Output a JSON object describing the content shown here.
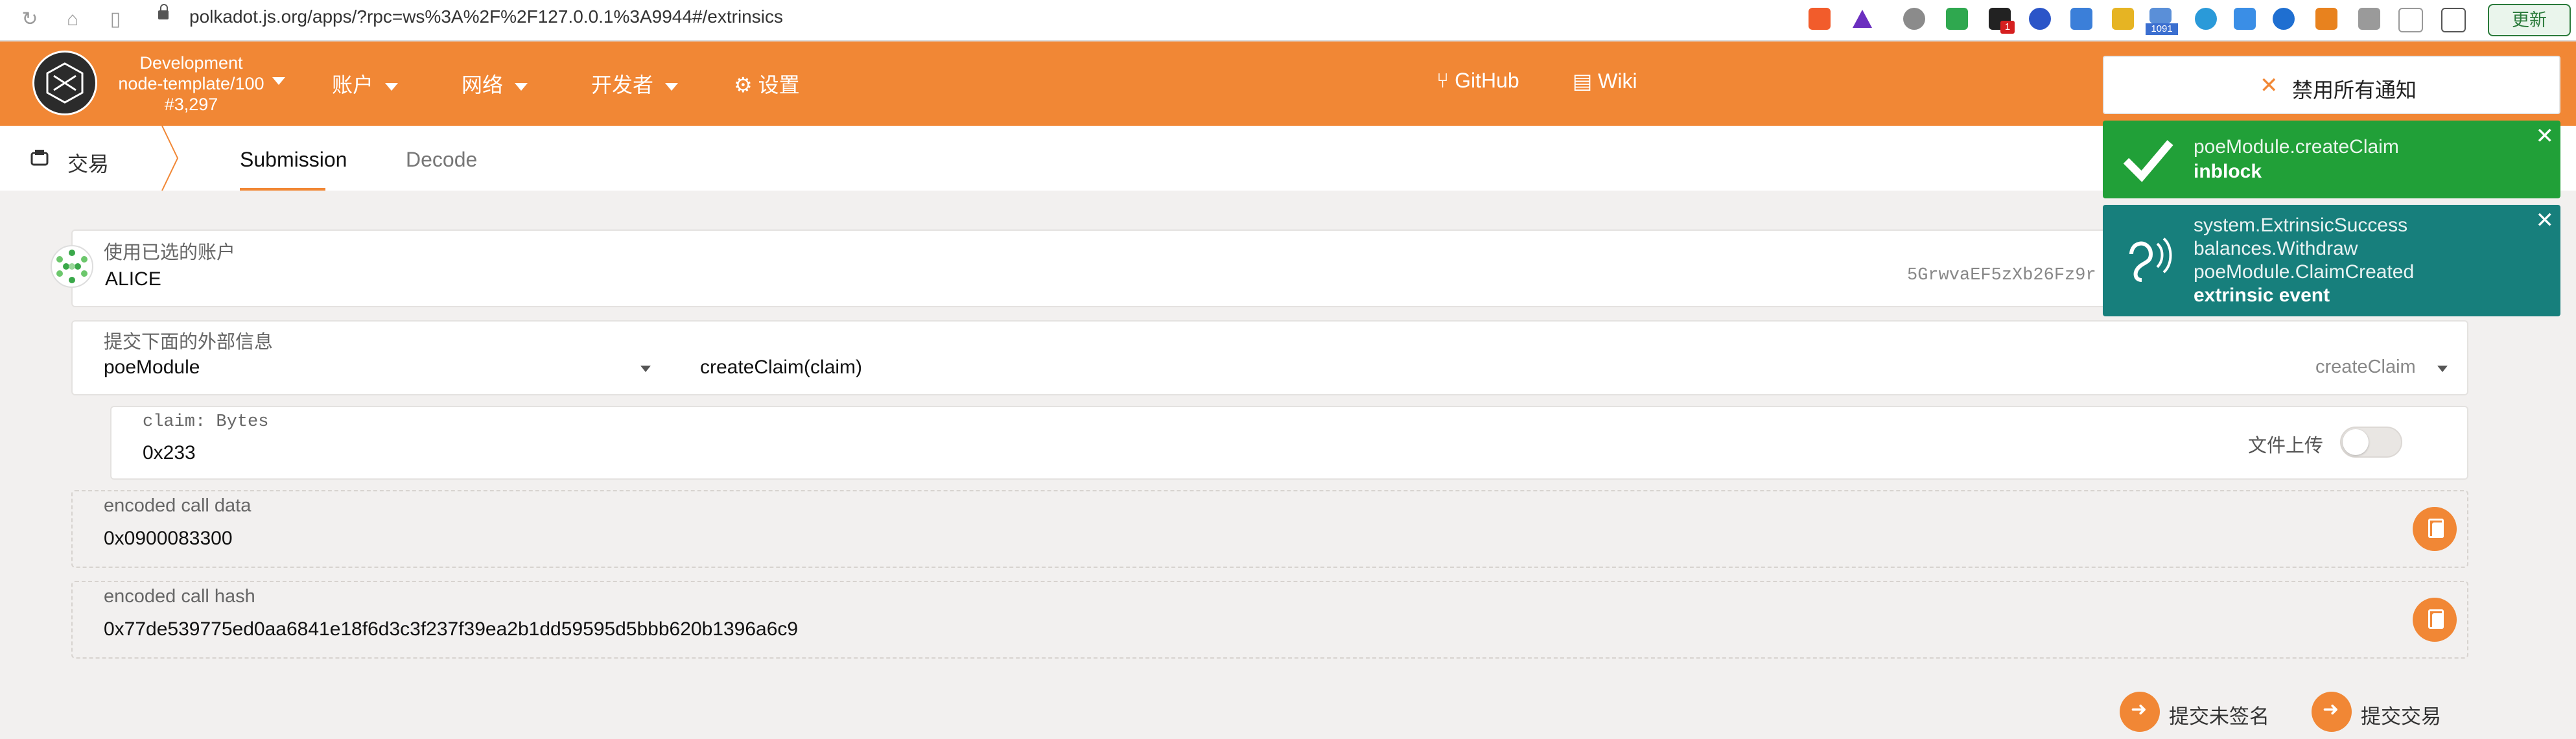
{
  "browser": {
    "url": "polkadot.js.org/apps/?rpc=ws%3A%2F%2F127.0.0.1%3A9944#/extrinsics",
    "update_label": "更新",
    "badges": {
      "ext_badge_1": "1",
      "ext_badge_1091": "1091"
    }
  },
  "header": {
    "chain": {
      "line1": "Development",
      "line2": "node-template/100",
      "line3": "#3,297"
    },
    "menu": [
      {
        "label": "账户"
      },
      {
        "label": "网络"
      },
      {
        "label": "开发者"
      },
      {
        "label": "设置"
      }
    ],
    "links": {
      "github": "GitHub",
      "wiki": "Wiki"
    }
  },
  "subnav": {
    "title": "交易",
    "tabs": [
      {
        "label": "Submission",
        "active": true
      },
      {
        "label": "Decode",
        "active": false
      }
    ]
  },
  "form": {
    "account": {
      "label": "使用已选的账户",
      "name": "ALICE",
      "address": "5GrwvaEF5zXb26Fz9r"
    },
    "extrinsic": {
      "label": "提交下面的外部信息",
      "module": "poeModule",
      "call": "createClaim(claim)",
      "call_selector": "createClaim"
    },
    "claim": {
      "label": "claim: Bytes",
      "value": "0x233",
      "file_upload_label": "文件上传"
    },
    "encoded_call_data": {
      "label": "encoded call data",
      "value": "0x0900083300"
    },
    "encoded_call_hash": {
      "label": "encoded call hash",
      "value": "0x77de539775ed0aa6841e18f6d3c3f237f39ea2b1dd59595d5bbb620b1396a6c9"
    }
  },
  "actions": {
    "sign_unsigned": "提交未签名",
    "submit": "提交交易"
  },
  "notifications": {
    "disable_all": "禁用所有通知",
    "inblock": {
      "title": "poeModule.createClaim",
      "status": "inblock"
    },
    "events": {
      "lines": [
        "system.ExtrinsicSuccess",
        "balances.Withdraw",
        "poeModule.ClaimCreated"
      ],
      "status": "extrinsic event"
    }
  },
  "colors": {
    "accent": "#f18735",
    "success": "#21a038",
    "event": "#177f7c"
  }
}
